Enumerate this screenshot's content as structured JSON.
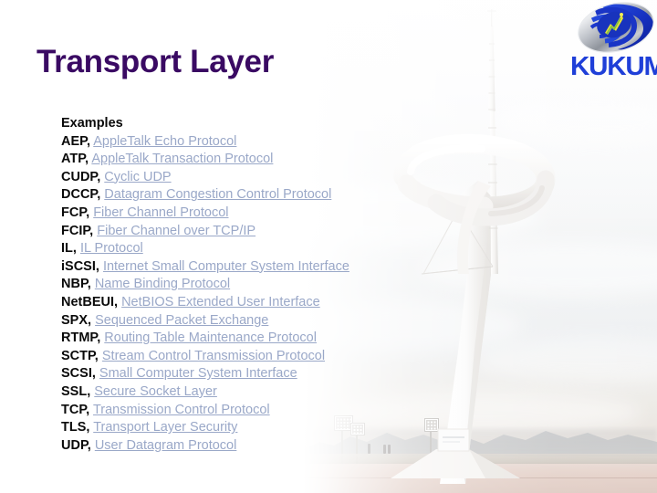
{
  "slide": {
    "title": "Transport Layer",
    "title_color": "#3a0a63",
    "background_description": "Montjuic Communications Tower photo faded into white",
    "link_color": "#9aa8c8",
    "text_color": "#0a0a0a"
  },
  "logo": {
    "wordmark": "KUKUM",
    "wordmark_color": "#1f3fd8",
    "emblem_name": "kukum-globe-swoosh-emblem"
  },
  "content": {
    "heading": "Examples",
    "entries": [
      {
        "abbr": "AEP,",
        "expansion": "AppleTalk Echo Protocol"
      },
      {
        "abbr": "ATP,",
        "expansion": "AppleTalk Transaction Protocol"
      },
      {
        "abbr": "CUDP,",
        "expansion": "Cyclic UDP"
      },
      {
        "abbr": "DCCP,",
        "expansion": "Datagram Congestion Control Protocol"
      },
      {
        "abbr": "FCP,",
        "expansion": "Fiber Channel Protocol"
      },
      {
        "abbr": "FCIP,",
        "expansion": "Fiber Channel over TCP/IP"
      },
      {
        "abbr": "IL,",
        "expansion": "IL Protocol"
      },
      {
        "abbr": "iSCSI,",
        "expansion": "Internet Small Computer System Interface"
      },
      {
        "abbr": "NBP,",
        "expansion": "Name Binding Protocol"
      },
      {
        "abbr": "NetBEUI,",
        "expansion": "NetBIOS Extended User Interface"
      },
      {
        "abbr": "SPX,",
        "expansion": "Sequenced Packet Exchange"
      },
      {
        "abbr": "RTMP,",
        "expansion": "Routing Table Maintenance Protocol"
      },
      {
        "abbr": "SCTP,",
        "expansion": "Stream Control Transmission Protocol"
      },
      {
        "abbr": "SCSI,",
        "expansion": "Small Computer System Interface"
      },
      {
        "abbr": "SSL,",
        "expansion": "Secure Socket Layer"
      },
      {
        "abbr": "TCP,",
        "expansion": "Transmission Control Protocol"
      },
      {
        "abbr": "TLS,",
        "expansion": "Transport Layer Security"
      },
      {
        "abbr": "UDP,",
        "expansion": "User Datagram Protocol"
      }
    ]
  }
}
